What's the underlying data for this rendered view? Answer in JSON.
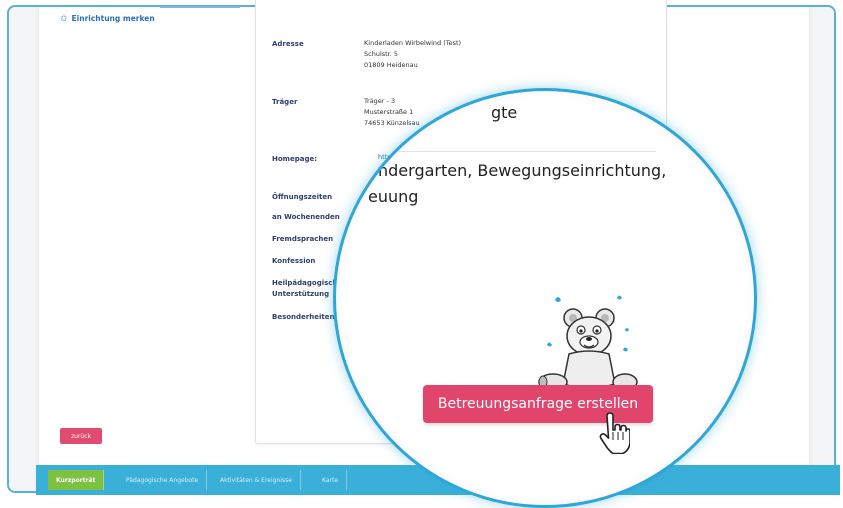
{
  "left": {
    "merken_label": "Einrichtung merken",
    "back_label": "zurück"
  },
  "details": {
    "address": {
      "label": "Adresse",
      "lines": [
        "Kinderladen Wirbelwind (Test)",
        "Schulstr. 5",
        "01809 Heidenau"
      ]
    },
    "traeger": {
      "label": "Träger",
      "lines": [
        "Träger - 3",
        "Musterstraße 1",
        "74653 Künzelsau"
      ]
    },
    "homepage": {
      "label": "Homepage:",
      "value": "http"
    },
    "rows": [
      {
        "label": "Öffnungszeiten"
      },
      {
        "label": "an Wochenenden"
      },
      {
        "label": "Fremdsprachen"
      },
      {
        "label": "Konfession"
      },
      {
        "label": "Heilpädagogische"
      },
      {
        "label": "Unterstützung"
      },
      {
        "label": "Besonderheiten"
      }
    ]
  },
  "lens": {
    "line1": "gte",
    "line2": "ndergarten, Bewegungseinrichtung,",
    "line3": "euung",
    "cta_label": "Betreuungsanfrage erstellen"
  },
  "tabs": [
    {
      "label": "Kurzporträt",
      "active": true
    },
    {
      "label": "Pädagogische Angebote",
      "active": false
    },
    {
      "label": "Aktivitäten & Ereignisse",
      "active": false
    },
    {
      "label": "Karte",
      "active": false
    }
  ],
  "colors": {
    "accent_blue": "#2fa6d8",
    "cta_pink": "#e2456c",
    "tab_active_green": "#7cc142",
    "label_navy": "#2f3e6b"
  },
  "icons": {
    "merken": "star-icon",
    "cursor": "hand-pointer-icon",
    "mascot": "bear-mascot"
  }
}
